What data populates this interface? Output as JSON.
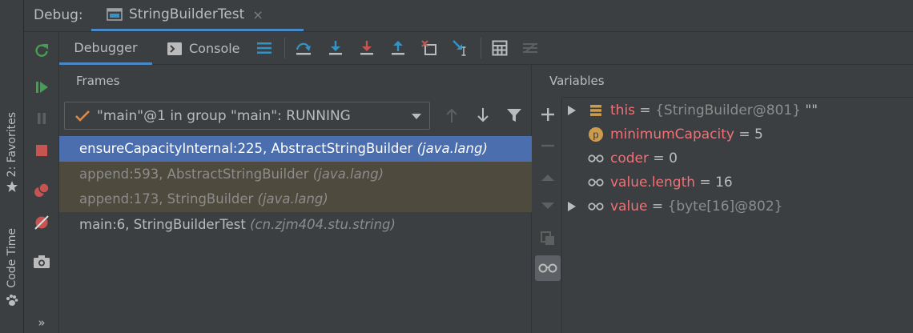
{
  "header": {
    "debug_label": "Debug:",
    "session_tab": "StringBuilderTest",
    "close_glyph": "×"
  },
  "left_strip": {
    "favorites": "2: Favorites",
    "code_time": "Code Time",
    "more": "»"
  },
  "toolbar": {
    "debugger_tab": "Debugger",
    "console_tab": "Console"
  },
  "frames": {
    "title": "Frames",
    "thread": "\"main\"@1 in group \"main\": RUNNING",
    "items": [
      {
        "method": "ensureCapacityInternal:225, AbstractStringBuilder ",
        "pkg": "(java.lang)"
      },
      {
        "method": "append:593, AbstractStringBuilder ",
        "pkg": "(java.lang)"
      },
      {
        "method": "append:173, StringBuilder ",
        "pkg": "(java.lang)"
      },
      {
        "method": "main:6, StringBuilderTest ",
        "pkg": "(cn.zjm404.stu.string)"
      }
    ]
  },
  "variables": {
    "title": "Variables",
    "items": [
      {
        "name": "this",
        "eq": " = ",
        "value": "{StringBuilder@801}",
        "extra": " \"\"",
        "icon": "field-stack-icon"
      },
      {
        "name": "minimumCapacity",
        "eq": " = ",
        "value": "5",
        "extra": "",
        "icon": "parameter-p-icon"
      },
      {
        "name": "coder",
        "eq": " = ",
        "value": "0",
        "extra": "",
        "icon": "watch-glasses-icon"
      },
      {
        "name": "value.length",
        "eq": " = ",
        "value": "16",
        "extra": "",
        "icon": "watch-glasses-icon"
      },
      {
        "name": "value",
        "eq": " = ",
        "value": "{byte[16]@802}",
        "extra": "",
        "icon": "watch-glasses-icon"
      }
    ]
  },
  "colors": {
    "accent": "#4a88c7",
    "selection": "#4b6eaf",
    "library_row": "#4e4a3e",
    "var_name": "#f07178",
    "green": "#499c54",
    "red": "#c75450",
    "blue": "#3592c4"
  }
}
